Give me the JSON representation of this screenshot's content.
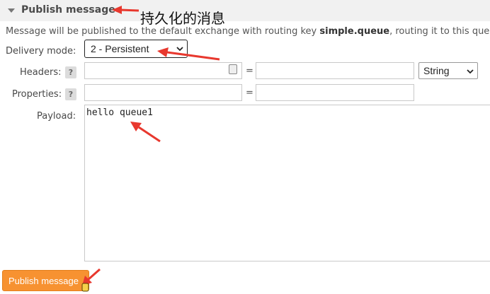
{
  "section": {
    "title": "Publish message",
    "annotation": "持久化的消息"
  },
  "info": {
    "prefix": "Message will be published to the default exchange with routing key ",
    "routing_key": "simple.queue",
    "suffix": ", routing it to this que"
  },
  "delivery": {
    "label": "Delivery mode:",
    "value": "2 - Persistent"
  },
  "headers": {
    "label": "Headers:",
    "help": "?",
    "key": "",
    "value": "",
    "type_value": "String",
    "equals": "="
  },
  "properties": {
    "label": "Properties:",
    "help": "?",
    "key": "",
    "value": "",
    "equals": "="
  },
  "payload": {
    "label": "Payload:",
    "value": "hello queue1"
  },
  "publish_button": {
    "label": "Publish message"
  },
  "colors": {
    "accent": "#f79231",
    "arrow": "#e8382e",
    "header_bg": "#f1f1f1"
  }
}
